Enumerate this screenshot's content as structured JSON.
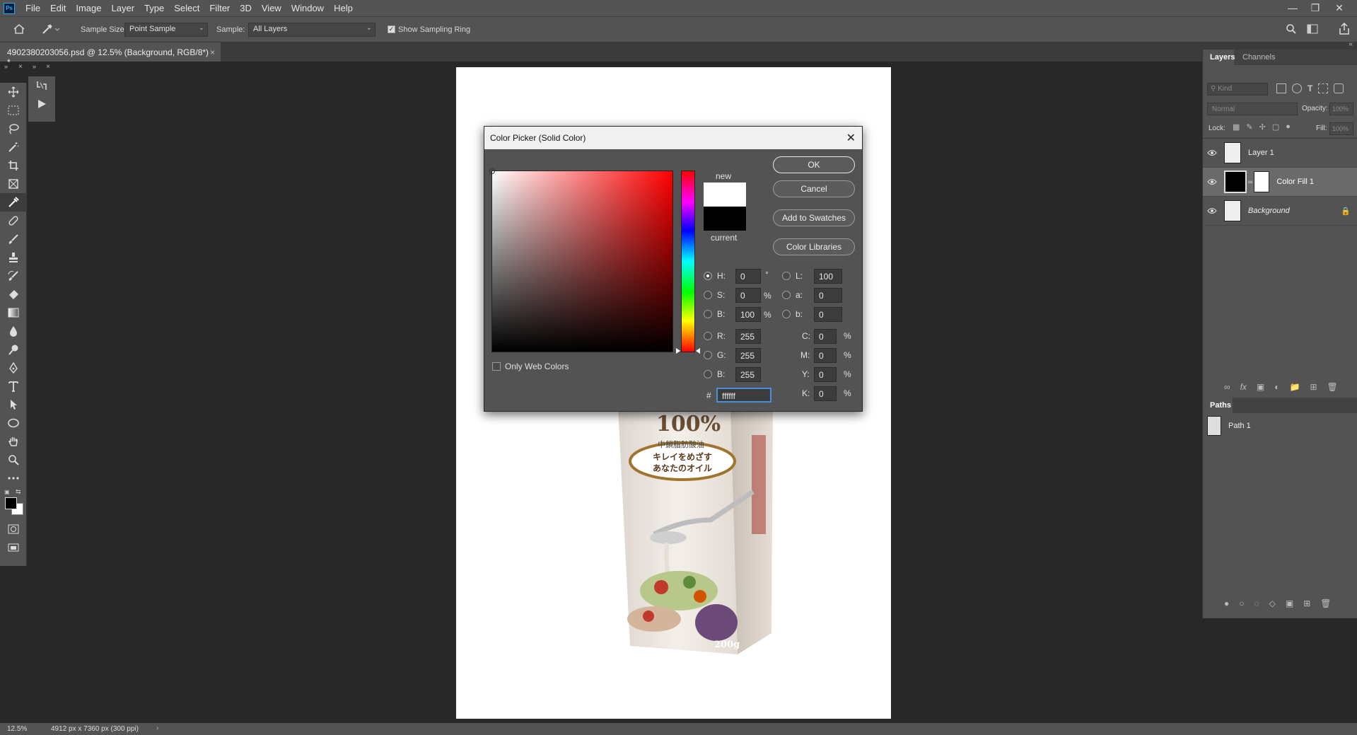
{
  "app": {
    "logo": "Ps",
    "accent": "#31a8ff"
  },
  "menu": {
    "items": [
      "File",
      "Edit",
      "Image",
      "Layer",
      "Type",
      "Select",
      "Filter",
      "3D",
      "View",
      "Window",
      "Help"
    ]
  },
  "options": {
    "sample_size_label": "Sample Size:",
    "sample_size_value": "Point Sample",
    "sample_label": "Sample:",
    "sample_value": "All Layers",
    "show_ring_label": "Show Sampling Ring"
  },
  "document": {
    "tab_title": "4902380203056.psd @ 12.5% (Background, RGB/8*) *"
  },
  "status": {
    "zoom": "12.5%",
    "doc_info": "4912 px x 7360 px (300 ppi)"
  },
  "panels": {
    "layers_tab": "Layers",
    "channels_tab": "Channels",
    "kind_placeholder": "Kind",
    "blend_mode": "Normal",
    "opacity_label": "Opacity:",
    "opacity_value": "100%",
    "lock_label": "Lock:",
    "fill_label": "Fill:",
    "fill_value": "100%",
    "layers": [
      {
        "name": "Layer 1"
      },
      {
        "name": "Color Fill 1"
      },
      {
        "name": "Background"
      }
    ],
    "paths_tab": "Paths",
    "paths": [
      {
        "name": "Path 1"
      }
    ]
  },
  "dialog": {
    "title": "Color Picker (Solid Color)",
    "ok": "OK",
    "cancel": "Cancel",
    "add_swatches": "Add to Swatches",
    "color_libraries": "Color Libraries",
    "new_label": "new",
    "current_label": "current",
    "new_color": "#ffffff",
    "current_color": "#000000",
    "hue_color": "#ff0000",
    "only_web_colors": "Only Web Colors",
    "hex_label": "#",
    "hex": "ffffff",
    "fields": {
      "H": {
        "label": "H:",
        "value": "0",
        "unit": "°"
      },
      "S": {
        "label": "S:",
        "value": "0",
        "unit": "%"
      },
      "Bv": {
        "label": "B:",
        "value": "100",
        "unit": "%"
      },
      "R": {
        "label": "R:",
        "value": "255"
      },
      "G": {
        "label": "G:",
        "value": "255"
      },
      "Bc": {
        "label": "B:",
        "value": "255"
      },
      "L": {
        "label": "L:",
        "value": "100"
      },
      "a": {
        "label": "a:",
        "value": "0"
      },
      "b": {
        "label": "b:",
        "value": "0"
      },
      "C": {
        "label": "C:",
        "value": "0",
        "unit": "%"
      },
      "M": {
        "label": "M:",
        "value": "0",
        "unit": "%"
      },
      "Y": {
        "label": "Y:",
        "value": "0",
        "unit": "%"
      },
      "K": {
        "label": "K:",
        "value": "0",
        "unit": "%"
      }
    }
  },
  "product": {
    "big_text": "100%",
    "sub_text": "中鎖脂肪酸油",
    "badge_line1": "キレイをめざす",
    "badge_line2": "あなたのオイル",
    "weight": "200g"
  }
}
